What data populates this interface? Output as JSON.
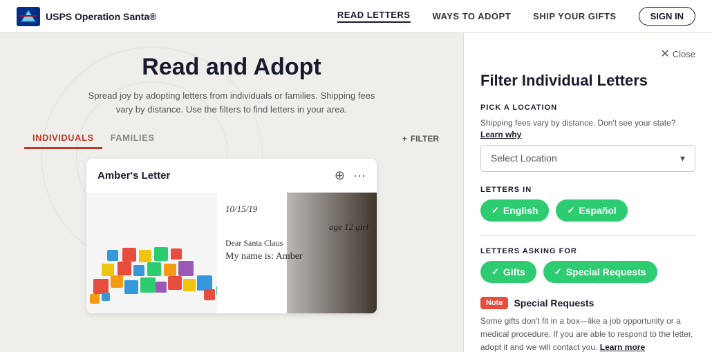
{
  "header": {
    "brand": "USPS Operation Santa®",
    "nav": [
      {
        "label": "READ LETTERS",
        "active": true
      },
      {
        "label": "WAYS TO ADOPT",
        "active": false
      },
      {
        "label": "SHIP YOUR GIFTS",
        "active": false
      }
    ],
    "sign_in": "SIGN IN"
  },
  "main": {
    "title": "Read and Adopt",
    "subtitle": "Spread joy by adopting letters from individuals or families. Shipping fees vary by distance. Use the filters to find letters in your area.",
    "tabs": [
      {
        "label": "INDIVIDUALS",
        "active": true
      },
      {
        "label": "FAMILIES",
        "active": false
      }
    ],
    "filter_btn": "FILTER",
    "letter_card": {
      "title": "Amber's Letter",
      "date": "10/15/19",
      "age_line": "age 12 girl",
      "dear_line": "Dear Santa Claus",
      "name_line": "My name is: Amber"
    }
  },
  "filter": {
    "close_label": "Close",
    "title": "Filter Individual Letters",
    "pick_location_label": "PICK A LOCATION",
    "shipping_note": "Shipping fees vary by distance. Don't see your state?",
    "learn_why": "Learn why",
    "select_location_placeholder": "Select Location",
    "letters_in_label": "LETTERS IN",
    "pills_language": [
      {
        "label": "English",
        "active": true
      },
      {
        "label": "Español",
        "active": true
      }
    ],
    "letters_asking_for_label": "LETTERS ASKING FOR",
    "pills_asking": [
      {
        "label": "Gifts",
        "active": true
      },
      {
        "label": "Special Requests",
        "active": true
      }
    ],
    "note_badge": "Note",
    "note_title": "Special Requests",
    "note_text": "Some gifts don't fit in a box—like a job opportunity or a medical procedure. If you are able to respond to the letter, adopt it and we will contact you.",
    "learn_more": "Learn more"
  }
}
